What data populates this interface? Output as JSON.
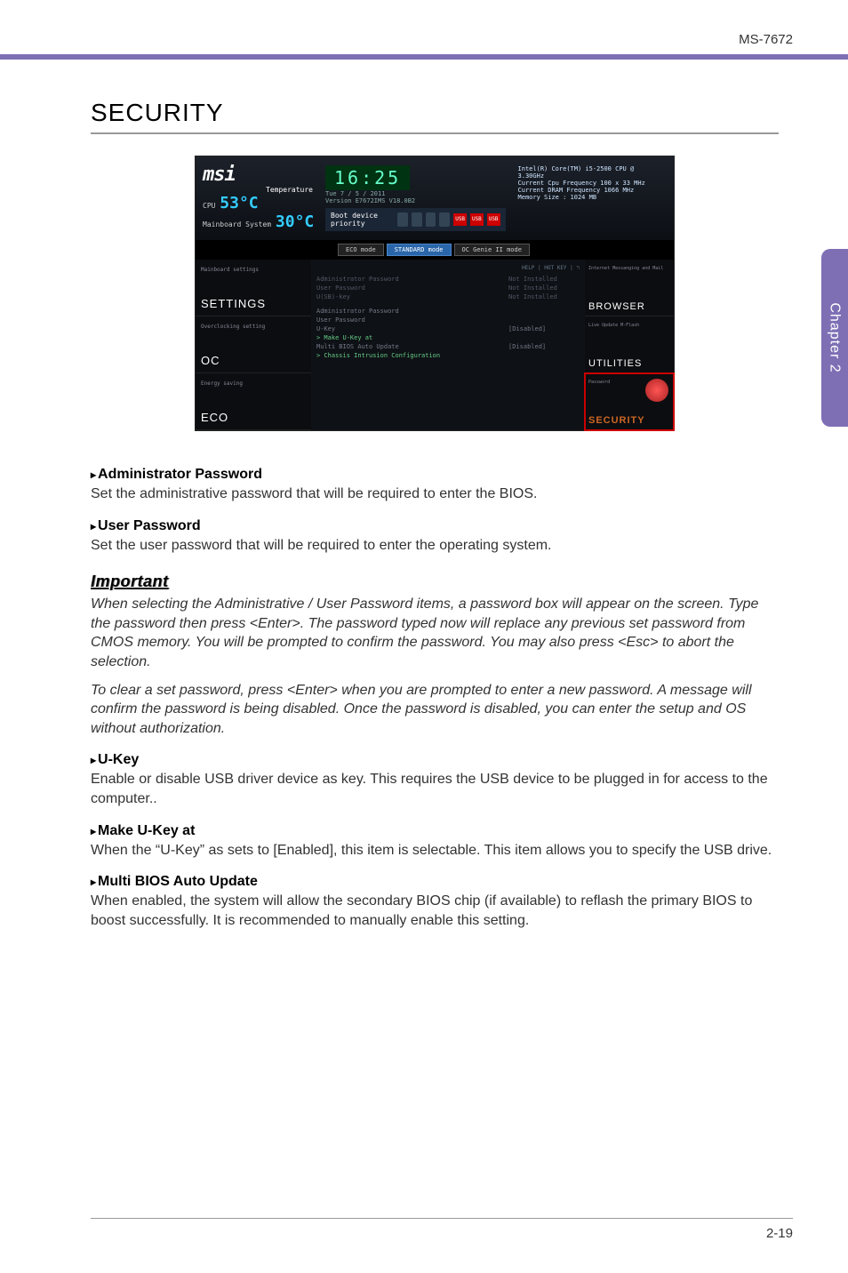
{
  "header": {
    "model": "MS-7672",
    "chapter": "Chapter 2"
  },
  "section": {
    "title": "SECURITY"
  },
  "bios": {
    "logo": "msi",
    "temp_label": "Temperature",
    "cpu_label": "CPU",
    "cpu_temp": "53°C",
    "mb_label": "Mainboard\nSystem",
    "mb_temp": "30°C",
    "clock": "16:25",
    "date": "Tue  7 / 5 / 2011",
    "version": "Version E7672IMS V18.0B2",
    "boot_label": "Boot device priority",
    "usb": "USB",
    "sys": [
      "Intel(R) Core(TM) i5-2500 CPU @ 3.30GHz",
      "Current Cpu Frequency 100 x 33 MHz",
      "Current DRAM Frequency 1066 MHz",
      "Memory Size : 1024 MB"
    ],
    "modes": [
      "ECO\nmode",
      "STANDARD\nmode",
      "OC Genie II\nmode"
    ],
    "help": "HELP | HOT KEY | ↰",
    "left": [
      {
        "sub": "Mainboard settings",
        "label": "SETTINGS"
      },
      {
        "sub": "Overclocking setting",
        "label": "OC"
      },
      {
        "sub": "Energy saving",
        "label": "ECO"
      }
    ],
    "right": [
      {
        "sub": "Internet\nMessanging and Mail",
        "label": "BROWSER"
      },
      {
        "sub": "Live Update\nM-Flash",
        "label": "UTILITIES"
      },
      {
        "sub": "Password",
        "label": "SECURITY"
      }
    ],
    "rows": [
      {
        "k": "Administrator Password",
        "v": "Not Installed"
      },
      {
        "k": "User Password",
        "v": "Not Installed"
      },
      {
        "k": "U(SB)-key",
        "v": "Not Installed"
      },
      {
        "k": "Administrator Password",
        "v": ""
      },
      {
        "k": "User Password",
        "v": ""
      },
      {
        "k": "U-Key",
        "v": "[Disabled]"
      },
      {
        "k": "> Make U-Key at",
        "v": ""
      },
      {
        "k": "Multi BIOS Auto Update",
        "v": "[Disabled]"
      },
      {
        "k": "> Chassis Intrusion Configuration",
        "v": ""
      }
    ]
  },
  "items": [
    {
      "h": "Administrator Password",
      "t": "Set the administrative password that will be required to enter the BIOS."
    },
    {
      "h": "User Password",
      "t": "Set the user password that will be required to enter the operating system."
    },
    {
      "h": "U-Key",
      "t": "Enable or disable USB driver device as key. This requires the USB device to be plugged in for access to the computer.."
    },
    {
      "h": "Make U-Key at",
      "t": "When the “U-Key” as sets to [Enabled], this item is selectable. This item allows you to specify the USB drive."
    },
    {
      "h": "Multi BIOS Auto Update",
      "t": "When enabled, the system will allow the secondary BIOS chip (if available) to reflash the primary BIOS to boost successfully. It is recommended to manually enable this setting."
    }
  ],
  "important": {
    "title": "Important",
    "p1": "When selecting the Administrative / User Password items, a password box will appear on the screen. Type the password then press <Enter>. The password typed now will replace any previous set password from CMOS memory. You will be prompted to confirm the password. You may also press <Esc> to abort the selection.",
    "p2": "To clear a set password, press <Enter> when you are prompted to enter a new password. A message will confirm the password is being disabled. Once the password is disabled, you can enter the setup and OS without authorization."
  },
  "footer": {
    "page": "2-19"
  }
}
